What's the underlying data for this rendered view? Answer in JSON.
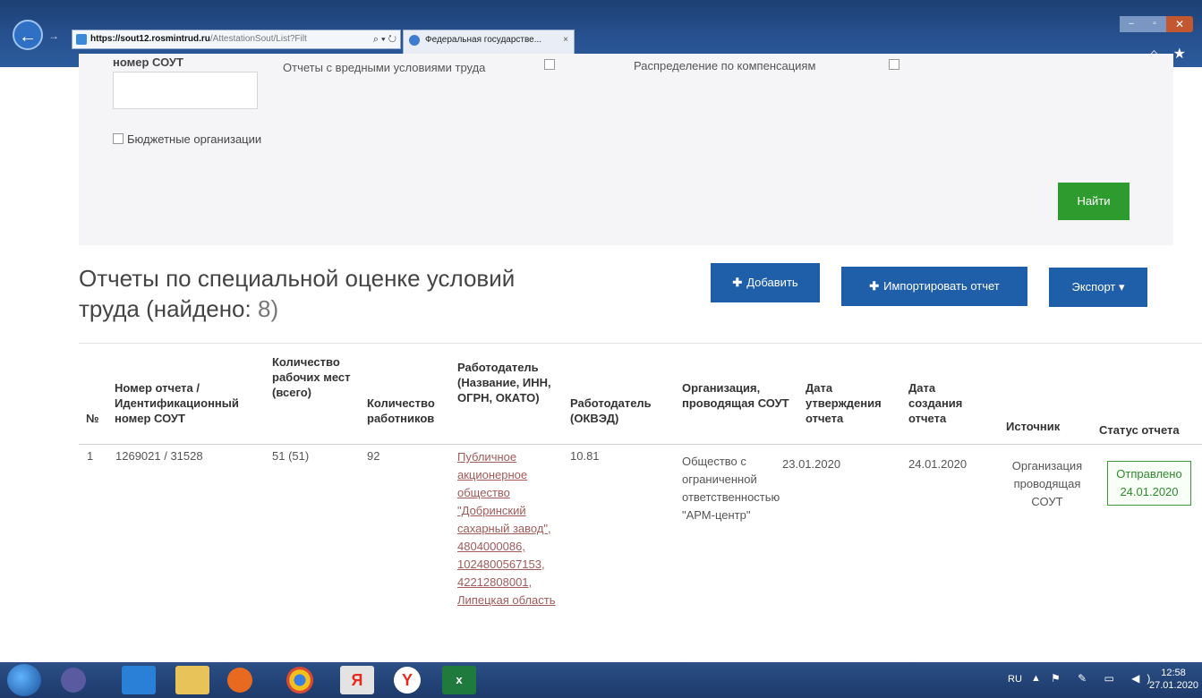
{
  "browser": {
    "url_host": "https://sout12.rosmintrud.ru",
    "url_path": "/AttestationSout/List?Filt",
    "addr_icons": "⌕ ▾ ↻",
    "tab_title": "Федеральная государстве...",
    "tab_close": "×",
    "win_min": "–",
    "win_max": "▫",
    "win_close": "✕",
    "chrome_icons": "⌂ ★"
  },
  "filter": {
    "sout_number_label": "номер СОУТ",
    "harmful_label": "Отчеты с вредными условиями труда",
    "compensation_label": "Распределение по компенсациям",
    "budget_label": "Бюджетные организации",
    "find_button": "Найти"
  },
  "heading": {
    "title": "Отчеты по специальной оценке условий труда (найдено: ",
    "count": "8",
    "suffix": ")"
  },
  "actions": {
    "add": "Добавить",
    "import": "Импортировать отчет",
    "export": "Экспорт ▾",
    "plus": "✚"
  },
  "table": {
    "headers": {
      "num": "№",
      "report_id": "Номер отчета / Идентификационный номер СОУТ",
      "workplaces": "Количество рабочих мест (всего)",
      "workers": "Количество работников",
      "employer": "Работодатель (Название, ИНН, ОГРН, ОКАТО)",
      "okved": "Работодатель (ОКВЭД)",
      "org": "Организация, проводящая СОУТ",
      "approved": "Дата утверждения отчета",
      "created": "Дата создания отчета",
      "source": "Источник",
      "status": "Статус отчета"
    },
    "rows": [
      {
        "num": "1",
        "report_id": "1269021 / 31528",
        "workplaces": "51 (51)",
        "workers": "92",
        "employer": "Публичное акционерное общество \"Добринский сахарный завод\", 4804000086, 1024800567153, 42212808001, Липецкая область",
        "okved": "10.81",
        "org": "Общество с ограниченной ответственностью \"АРМ-центр\"",
        "approved": "23.01.2020",
        "created": "24.01.2020",
        "source": "Организация проводящая СОУТ",
        "status": "Отправлено 24.01.2020"
      }
    ]
  },
  "taskbar": {
    "yandex": "Я",
    "ybrowser": "Y",
    "excel": "x",
    "lang": "RU",
    "tray_arrow": "▲",
    "tray_icons": "⚑ ✎ ▭ ◀)",
    "time": "12:58",
    "date": "27.01.2020"
  }
}
